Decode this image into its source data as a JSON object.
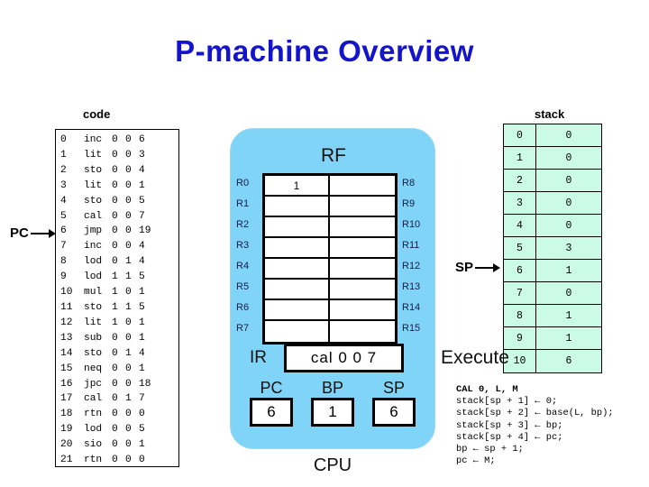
{
  "title": "P-machine Overview",
  "code_panel": {
    "label": "code",
    "rows": [
      {
        "addr": "0",
        "op": "inc",
        "f1": "0",
        "f2": "0",
        "f3": "6"
      },
      {
        "addr": "1",
        "op": "lit",
        "f1": "0",
        "f2": "0",
        "f3": "3"
      },
      {
        "addr": "2",
        "op": "sto",
        "f1": "0",
        "f2": "0",
        "f3": "4"
      },
      {
        "addr": "3",
        "op": "lit",
        "f1": "0",
        "f2": "0",
        "f3": "1"
      },
      {
        "addr": "4",
        "op": "sto",
        "f1": "0",
        "f2": "0",
        "f3": "5"
      },
      {
        "addr": "5",
        "op": "cal",
        "f1": "0",
        "f2": "0",
        "f3": "7"
      },
      {
        "addr": "6",
        "op": "jmp",
        "f1": "0",
        "f2": "0",
        "f3": "19"
      },
      {
        "addr": "7",
        "op": "inc",
        "f1": "0",
        "f2": "0",
        "f3": "4"
      },
      {
        "addr": "8",
        "op": "lod",
        "f1": "0",
        "f2": "1",
        "f3": "4"
      },
      {
        "addr": "9",
        "op": "lod",
        "f1": "1",
        "f2": "1",
        "f3": "5"
      },
      {
        "addr": "10",
        "op": "mul",
        "f1": "1",
        "f2": "0",
        "f3": "1"
      },
      {
        "addr": "11",
        "op": "sto",
        "f1": "1",
        "f2": "1",
        "f3": "5"
      },
      {
        "addr": "12",
        "op": "lit",
        "f1": "1",
        "f2": "0",
        "f3": "1"
      },
      {
        "addr": "13",
        "op": "sub",
        "f1": "0",
        "f2": "0",
        "f3": "1"
      },
      {
        "addr": "14",
        "op": "sto",
        "f1": "0",
        "f2": "1",
        "f3": "4"
      },
      {
        "addr": "15",
        "op": "neq",
        "f1": "0",
        "f2": "0",
        "f3": "1"
      },
      {
        "addr": "16",
        "op": "jpc",
        "f1": "0",
        "f2": "0",
        "f3": "18"
      },
      {
        "addr": "17",
        "op": "cal",
        "f1": "0",
        "f2": "1",
        "f3": "7"
      },
      {
        "addr": "18",
        "op": "rtn",
        "f1": "0",
        "f2": "0",
        "f3": "0"
      },
      {
        "addr": "19",
        "op": "lod",
        "f1": "0",
        "f2": "0",
        "f3": "5"
      },
      {
        "addr": "20",
        "op": "sio",
        "f1": "0",
        "f2": "0",
        "f3": "1"
      },
      {
        "addr": "21",
        "op": "rtn",
        "f1": "0",
        "f2": "0",
        "f3": "0"
      }
    ]
  },
  "pc_pointer": {
    "label": "PC",
    "points_at_code_address": "6"
  },
  "cpu": {
    "label": "CPU",
    "rf": {
      "title": "RF",
      "rows": [
        {
          "left_name": "R0",
          "left_value": "1",
          "right_name": "R8",
          "right_value": ""
        },
        {
          "left_name": "R1",
          "left_value": "",
          "right_name": "R9",
          "right_value": ""
        },
        {
          "left_name": "R2",
          "left_value": "",
          "right_name": "R10",
          "right_value": ""
        },
        {
          "left_name": "R3",
          "left_value": "",
          "right_name": "R11",
          "right_value": ""
        },
        {
          "left_name": "R4",
          "left_value": "",
          "right_name": "R12",
          "right_value": ""
        },
        {
          "left_name": "R5",
          "left_value": "",
          "right_name": "R13",
          "right_value": ""
        },
        {
          "left_name": "R6",
          "left_value": "",
          "right_name": "R14",
          "right_value": ""
        },
        {
          "left_name": "R7",
          "left_value": "",
          "right_name": "R15",
          "right_value": ""
        }
      ]
    },
    "ir": {
      "label": "IR",
      "value": "cal 0 0 7"
    },
    "registers": [
      {
        "label": "PC",
        "value": "6"
      },
      {
        "label": "BP",
        "value": "1"
      },
      {
        "label": "SP",
        "value": "6"
      }
    ]
  },
  "stack_panel": {
    "label": "stack",
    "rows": [
      {
        "index": "0",
        "value": "0"
      },
      {
        "index": "1",
        "value": "0"
      },
      {
        "index": "2",
        "value": "0"
      },
      {
        "index": "3",
        "value": "0"
      },
      {
        "index": "4",
        "value": "0"
      },
      {
        "index": "5",
        "value": "3"
      },
      {
        "index": "6",
        "value": "1"
      },
      {
        "index": "7",
        "value": "0"
      },
      {
        "index": "8",
        "value": "1"
      },
      {
        "index": "9",
        "value": "1"
      },
      {
        "index": "10",
        "value": "6"
      }
    ]
  },
  "sp_pointer": {
    "label": "SP",
    "points_at_stack_index": "6"
  },
  "execute": {
    "title": "Execute",
    "heading": "CAL 0, L, M",
    "lines": [
      "stack[sp + 1] ← 0;",
      "stack[sp + 2] ← base(L, bp);",
      "stack[sp + 3] ← bp;",
      "stack[sp + 4] ← pc;",
      "bp ← sp + 1;",
      "pc ← M;"
    ]
  },
  "colors": {
    "title_blue": "#1414cc",
    "cpu_blue": "#7fd4f8",
    "stack_green": "#cbfbe6",
    "outline_black": "#000000"
  }
}
